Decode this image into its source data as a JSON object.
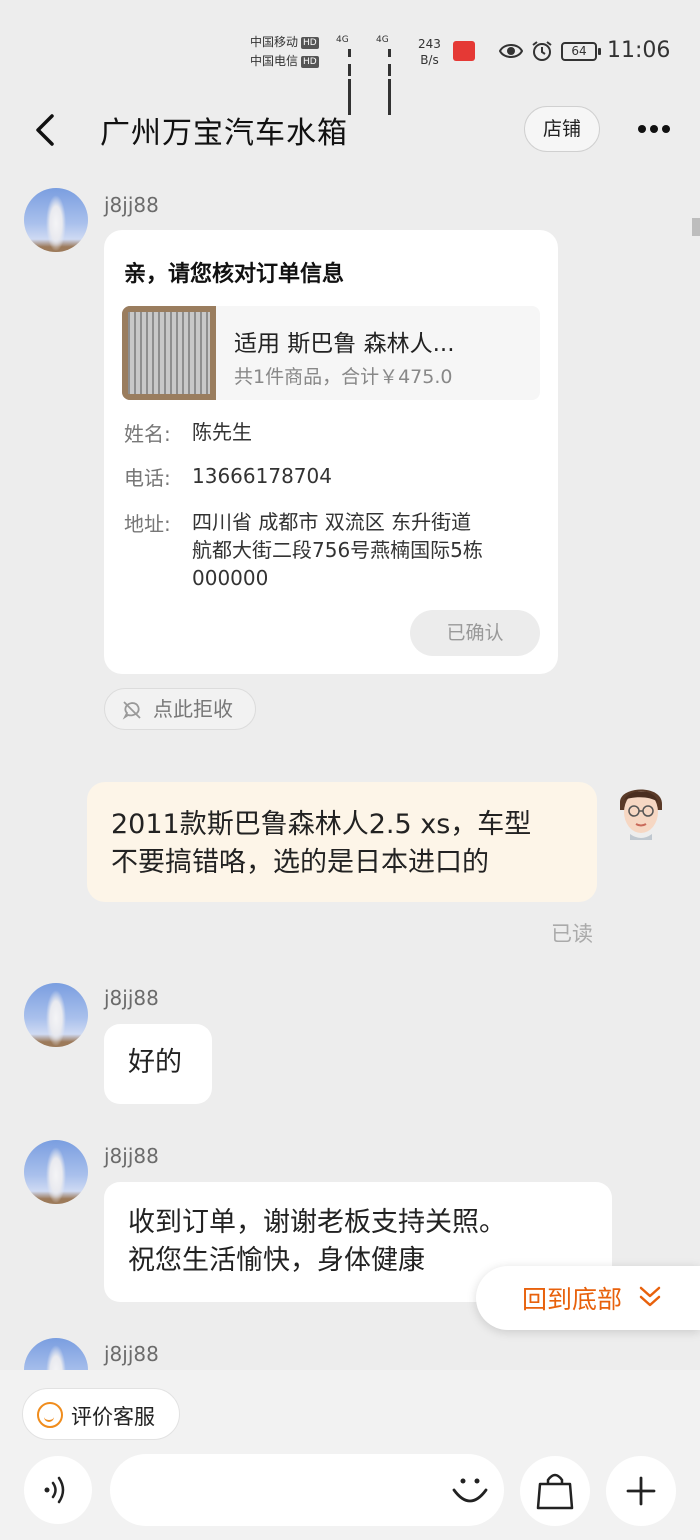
{
  "status_bar": {
    "carrier1": "中国移动",
    "carrier2": "中国电信",
    "hd": "HD",
    "net_type": "4G",
    "speed_value": "243",
    "speed_unit": "B/s",
    "battery": "64",
    "time": "11:06"
  },
  "header": {
    "title": "广州万宝汽车水箱",
    "shop_button": "店铺"
  },
  "messages": {
    "order": {
      "sender": "j8jj88",
      "card_title": "亲，请您核对订单信息",
      "product_name": "适用 斯巴鲁 森林人...",
      "product_total": "共1件商品，合计￥475.0",
      "name_label": "姓名:",
      "name_value": "陈先生",
      "phone_label": "电话:",
      "phone_value": "13666178704",
      "address_label": "地址:",
      "address_line1": "四川省 成都市 双流区 东升街道",
      "address_line2": "航都大街二段756号燕楠国际5栋",
      "address_line3": "000000",
      "confirm_button": "已确认"
    },
    "reject_chip": "点此拒收",
    "mine": {
      "line1": "2011款斯巴鲁森林人2.5 xs，车型",
      "line2": "不要搞错咯，选的是日本进口的",
      "status": "已读"
    },
    "reply1": {
      "sender": "j8jj88",
      "text": "好的"
    },
    "reply2": {
      "sender": "j8jj88",
      "line1": "收到订单，谢谢老板支持关照。",
      "line2": "祝您生活愉快，身体健康"
    },
    "reply3": {
      "sender": "j8jj88"
    }
  },
  "jump_to_bottom": "回到底部",
  "bottom": {
    "rate_service": "评价客服",
    "input_placeholder": ""
  },
  "colors": {
    "accent_orange": "#e8610c",
    "my_bubble": "#fdf5e8",
    "background": "#ededed"
  },
  "icons": [
    "back-arrow-icon",
    "more-icon",
    "voice-icon",
    "emoji-icon",
    "bag-icon",
    "plus-icon",
    "smile-icon",
    "reject-icon",
    "chevron-double-down-icon",
    "eye-icon",
    "alarm-icon"
  ]
}
